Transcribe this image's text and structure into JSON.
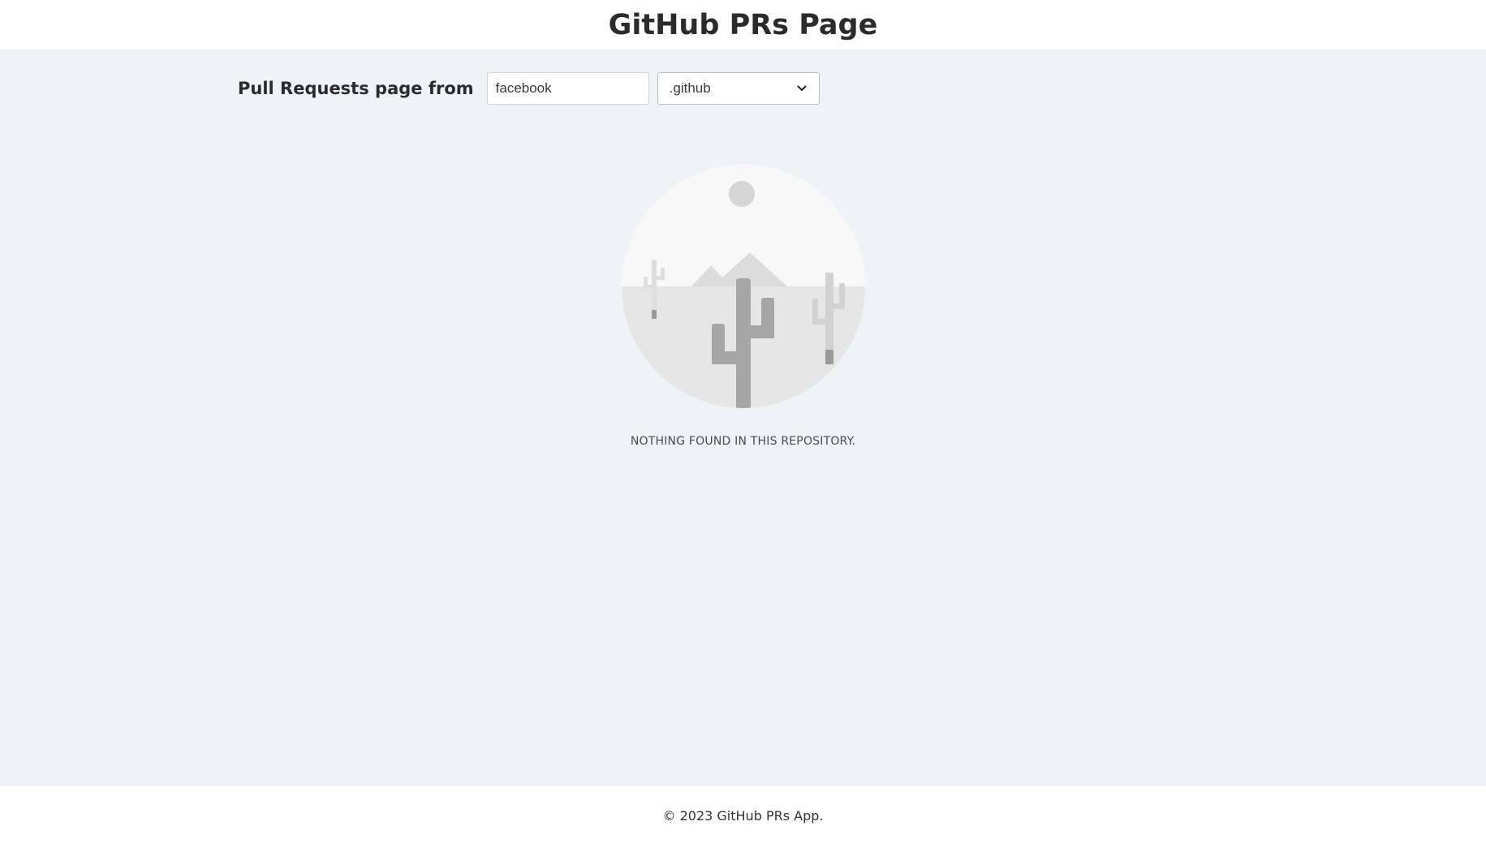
{
  "header": {
    "title": "GitHub PRs Page"
  },
  "controls": {
    "label": "Pull Requests page from",
    "owner_input_value": "facebook",
    "repo_select_value": ".github"
  },
  "empty_state": {
    "illustration_icon": "desert-cactus-icon",
    "message": "NOTHING FOUND IN THIS REPOSITORY."
  },
  "footer": {
    "copyright": "© 2023 GitHub PRs App."
  },
  "colors": {
    "page_background": "#eff3f8",
    "header_background": "#ffffff",
    "footer_background": "#ffffff"
  }
}
